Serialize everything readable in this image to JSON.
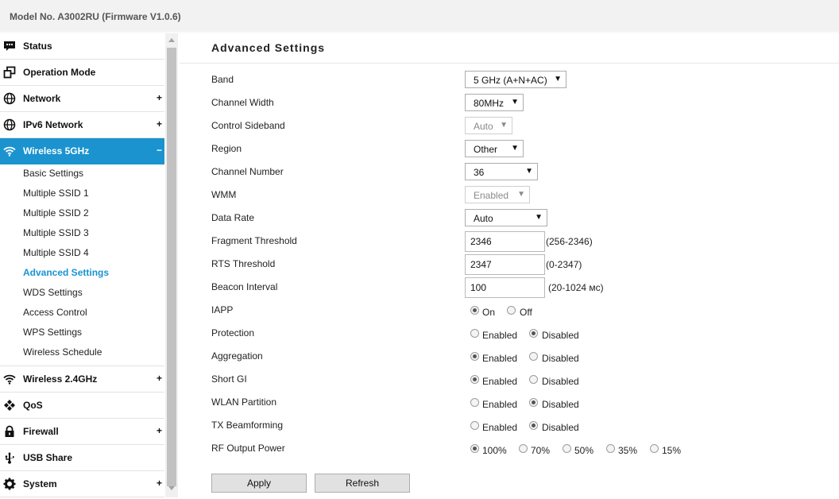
{
  "header": {
    "model": "Model No. A3002RU (Firmware V1.0.6)"
  },
  "sidebar": {
    "status": "Status",
    "operation_mode": "Operation Mode",
    "network": "Network",
    "ipv6_network": "IPv6 Network",
    "wireless_5g": "Wireless 5GHz",
    "wireless_24g": "Wireless 2.4GHz",
    "qos": "QoS",
    "firewall": "Firewall",
    "usb_share": "USB Share",
    "system": "System",
    "expand": "+",
    "collapse": "−",
    "sub": {
      "basic": "Basic Settings",
      "mssid1": "Multiple SSID 1",
      "mssid2": "Multiple SSID 2",
      "mssid3": "Multiple SSID 3",
      "mssid4": "Multiple SSID 4",
      "advanced": "Advanced Settings",
      "wds": "WDS Settings",
      "access": "Access Control",
      "wps": "WPS Settings",
      "schedule": "Wireless Schedule"
    },
    "accent_color": "#1a93cf"
  },
  "main": {
    "title": "Advanced Settings",
    "labels": {
      "band": "Band",
      "channel_width": "Channel Width",
      "control_sideband": "Control Sideband",
      "region": "Region",
      "channel_number": "Channel Number",
      "wmm": "WMM",
      "data_rate": "Data Rate",
      "fragment": "Fragment Threshold",
      "rts": "RTS Threshold",
      "beacon": "Beacon Interval",
      "iapp": "IAPP",
      "protection": "Protection",
      "aggregation": "Aggregation",
      "short_gi": "Short GI",
      "wlan_partition": "WLAN Partition",
      "tx_beamforming": "TX Beamforming",
      "rf_power": "RF Output Power"
    },
    "values": {
      "band": "5 GHz (A+N+AC)",
      "channel_width": "80MHz",
      "control_sideband": "Auto",
      "region": "Other",
      "channel_number": "36",
      "wmm": "Enabled",
      "data_rate": "Auto",
      "fragment": "2346",
      "rts": "2347",
      "beacon": "100"
    },
    "hints": {
      "fragment": "(256-2346)",
      "rts": "(0-2347)",
      "beacon": "(20-1024 мс)"
    },
    "options": {
      "on": "On",
      "off": "Off",
      "enabled": "Enabled",
      "disabled": "Disabled",
      "p100": "100%",
      "p70": "70%",
      "p50": "50%",
      "p35": "35%",
      "p15": "15%"
    },
    "selected": {
      "iapp": "On",
      "protection": "Disabled",
      "aggregation": "Enabled",
      "short_gi": "Enabled",
      "wlan_partition": "Disabled",
      "tx_beamforming": "Disabled",
      "rf_power": "100%"
    },
    "buttons": {
      "apply": "Apply",
      "refresh": "Refresh"
    }
  }
}
